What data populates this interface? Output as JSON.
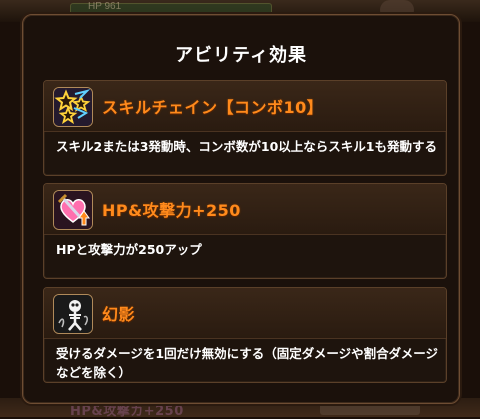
{
  "dialog": {
    "title": "アビリティ効果"
  },
  "background": {
    "hp_label": "HP",
    "hp_value": "961",
    "bottom_ghost_text": "HP&攻撃カ+250"
  },
  "abilities": [
    {
      "name": "スキルチェイン【コンボ10】",
      "icon": "star-chain-icon",
      "description": "スキル2または3発動時、コンボ数が10以上ならスキル1も発動する"
    },
    {
      "name": "HP&攻撃力+250",
      "icon": "heart-sword-icon",
      "description": "HPと攻撃力が250アップ"
    },
    {
      "name": "幻影",
      "icon": "phantom-skeleton-icon",
      "description": "受けるダメージを1回だけ無効にする（固定ダメージや割合ダメージなどを除く）"
    }
  ],
  "colors": {
    "ability_name": "#ff8a1c",
    "description_text": "#ffffff",
    "dialog_border": "#6e4d33"
  }
}
